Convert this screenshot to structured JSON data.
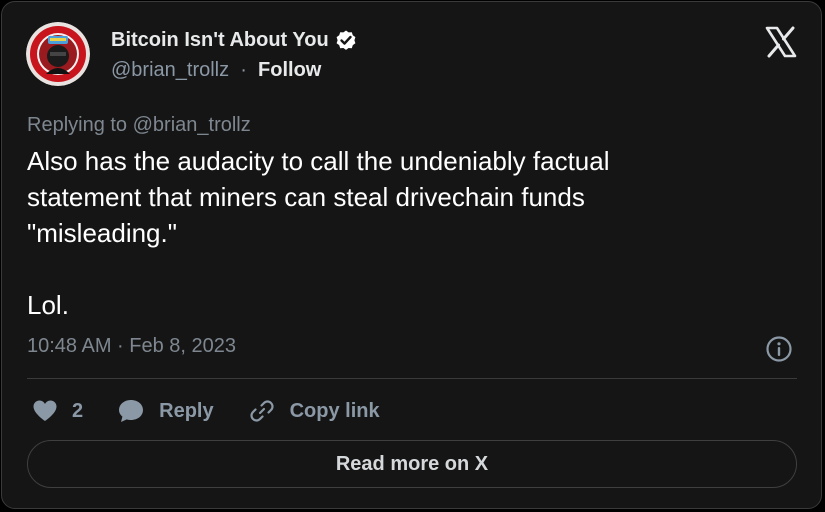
{
  "author": {
    "display_name": "Bitcoin Isn't About You",
    "handle": "@brian_trollz",
    "separator": "·",
    "follow_label": "Follow"
  },
  "tweet": {
    "reply_to": "Replying to @brian_trollz",
    "text": "Also has the audacity to call the undeniably factual\nstatement that miners can steal drivechain funds\n\"misleading.\"\n\nLol.",
    "timestamp": "10:48 AM · Feb 8, 2023"
  },
  "actions": {
    "like_count": "2",
    "reply_label": "Reply",
    "copy_link_label": "Copy link"
  },
  "read_more_label": "Read more on X",
  "colors": {
    "background": "#151515",
    "text": "#ffffff",
    "muted": "#8b98a5",
    "border": "#3a3a3a"
  }
}
